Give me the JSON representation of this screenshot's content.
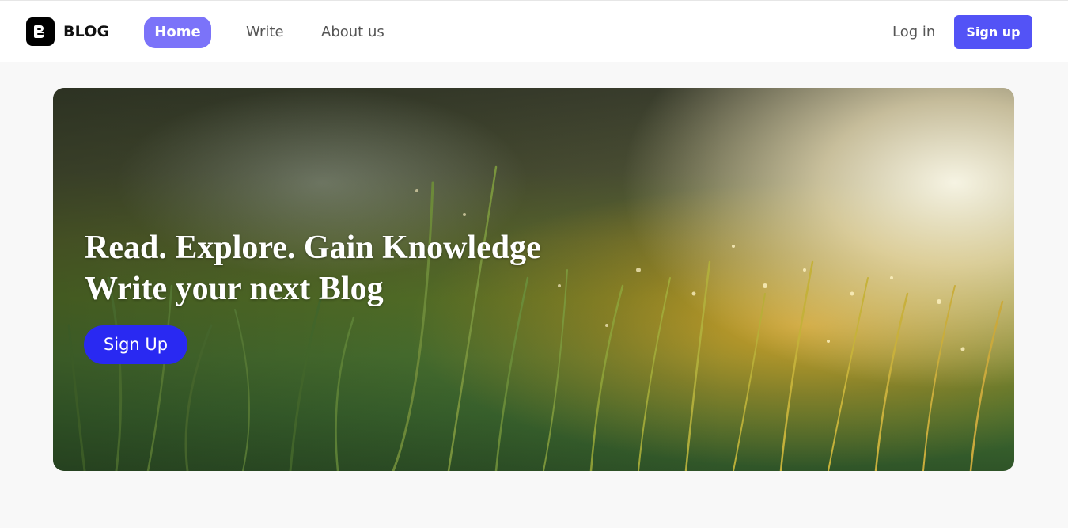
{
  "nav": {
    "logo_text": "BLOG",
    "links": [
      {
        "label": "Home",
        "active": true
      },
      {
        "label": "Write"
      },
      {
        "label": "About us"
      }
    ],
    "login_label": "Log in",
    "signup_label": "Sign up"
  },
  "hero": {
    "title_line1": "Read. Explore. Gain Knowledge",
    "title_line2": "Write your next Blog",
    "cta_label": "Sign Up",
    "image_icon": "grass-meadow-photo"
  },
  "colors": {
    "accent_active": "#7b73f9",
    "accent_signup": "#5353f6",
    "cta": "#2929f2",
    "background": "#f8f8f8"
  }
}
